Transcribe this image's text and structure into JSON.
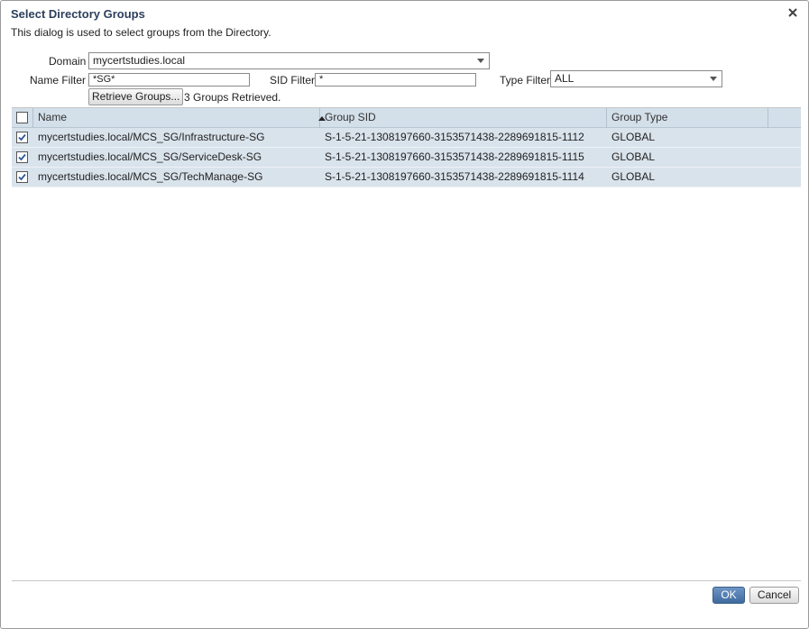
{
  "dialog": {
    "title": "Select Directory Groups",
    "description": "This dialog is used to select groups from the Directory."
  },
  "form": {
    "domain_label": "Domain",
    "domain_value": "mycertstudies.local",
    "name_filter_label": "Name Filter",
    "name_filter_value": "*SG*",
    "sid_filter_label": "SID Filter",
    "sid_filter_value": "*",
    "type_filter_label": "Type Filter",
    "type_filter_value": "ALL",
    "retrieve_button": "Retrieve Groups...",
    "status": "3 Groups Retrieved."
  },
  "table": {
    "columns": [
      "Name",
      "Group SID",
      "Group Type"
    ],
    "rows": [
      {
        "checked": true,
        "name": "mycertstudies.local/MCS_SG/Infrastructure-SG",
        "sid": "S-1-5-21-1308197660-3153571438-2289691815-1112",
        "type": "GLOBAL"
      },
      {
        "checked": true,
        "name": "mycertstudies.local/MCS_SG/ServiceDesk-SG",
        "sid": "S-1-5-21-1308197660-3153571438-2289691815-1115",
        "type": "GLOBAL"
      },
      {
        "checked": true,
        "name": "mycertstudies.local/MCS_SG/TechManage-SG",
        "sid": "S-1-5-21-1308197660-3153571438-2289691815-1114",
        "type": "GLOBAL"
      }
    ]
  },
  "footer": {
    "ok_label": "OK",
    "cancel_label": "Cancel"
  },
  "icons": {
    "close": "close-icon",
    "dropdown": "chevron-down-icon",
    "sort": "sort-ascending-icon",
    "check": "checkmark-icon"
  },
  "colors": {
    "title": "#2b3f5c",
    "header_bg": "#d3dfe9",
    "row_selected_bg": "#d9e3ec",
    "ok_button": "#4f7cb3"
  }
}
